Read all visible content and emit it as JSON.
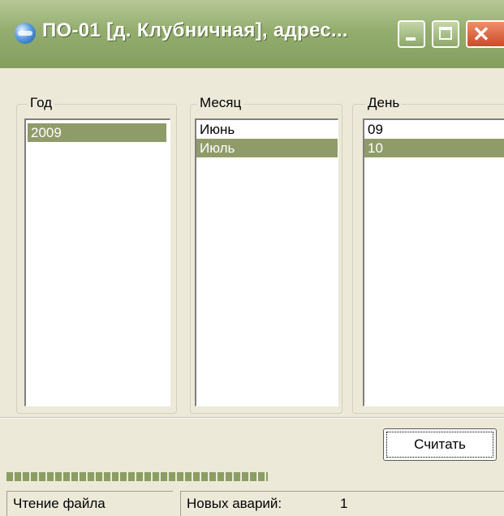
{
  "window": {
    "title": "ПО-01 [д. Клубничная], адрес...",
    "icon": "globe-app-icon",
    "controls": {
      "minimize": "minimize-icon",
      "maximize": "maximize-icon",
      "close": "close-icon"
    }
  },
  "groups": {
    "year": {
      "label": "Год",
      "items": [
        "2009"
      ],
      "selected": "2009"
    },
    "month": {
      "label": "Месяц",
      "items": [
        "Июнь",
        "Июль"
      ],
      "selected": "Июль"
    },
    "day": {
      "label": "День",
      "items": [
        "09",
        "10"
      ],
      "selected": "10"
    }
  },
  "actions": {
    "read_label": "Считать"
  },
  "status": {
    "file_reading": "Чтение файла",
    "new_accidents_label": "Новых аварий:",
    "new_accidents_count": "1"
  },
  "colors": {
    "titlebar": "#93ad6e",
    "selection": "#8f9c6a",
    "face": "#ece9d8",
    "close_button": "#cc4a2a"
  }
}
